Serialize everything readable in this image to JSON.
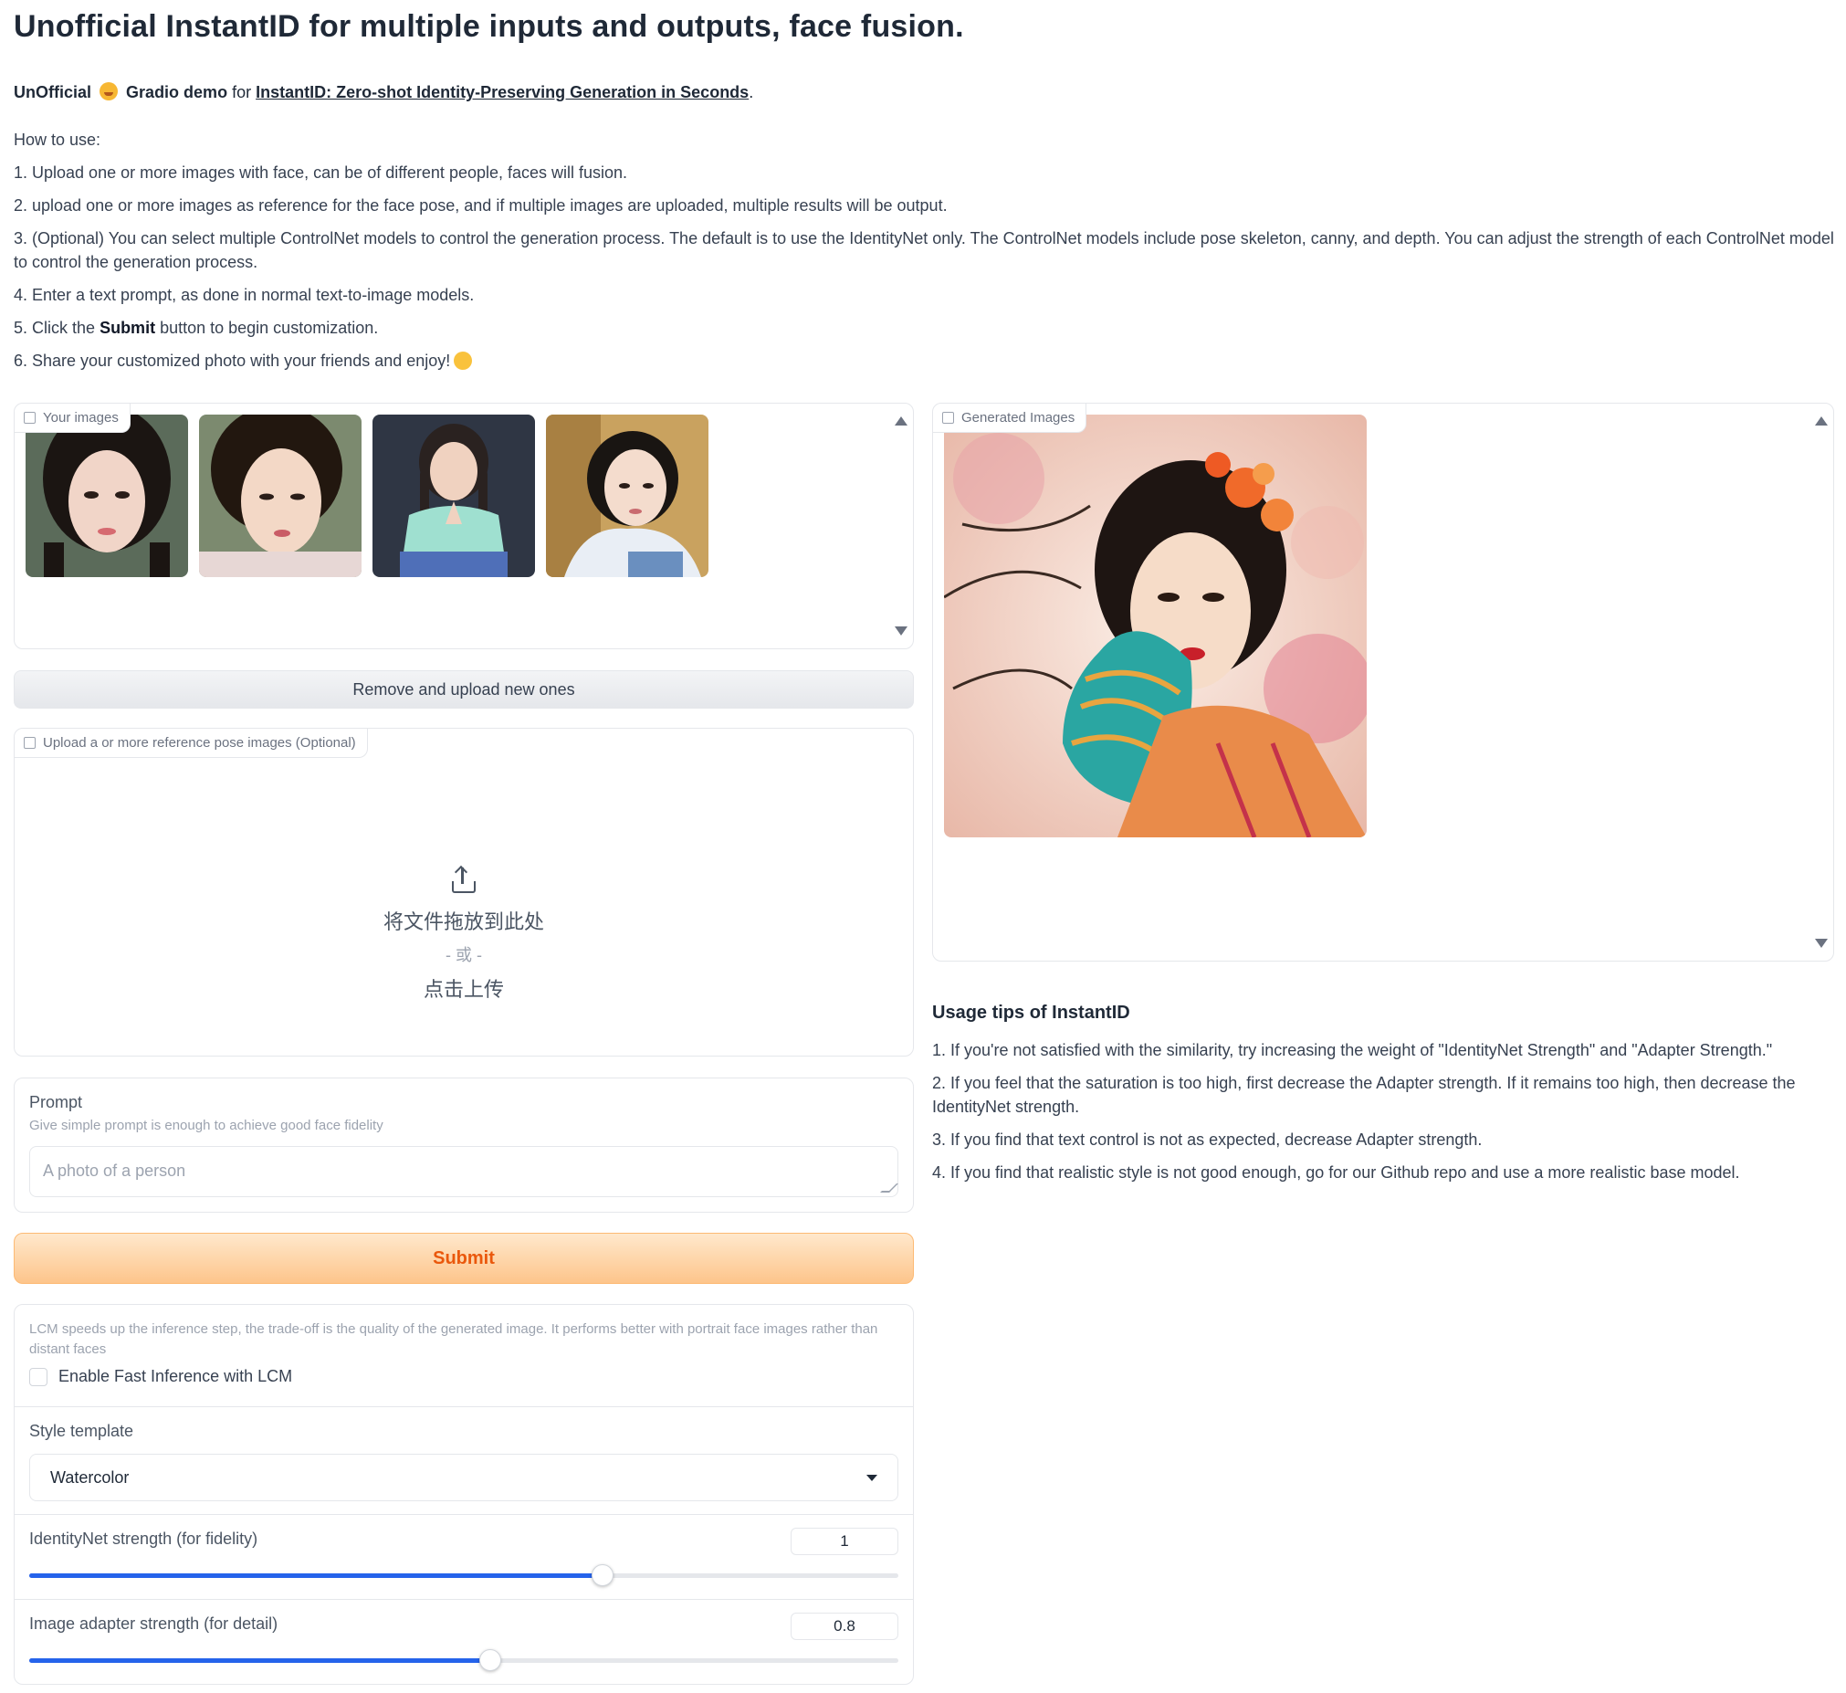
{
  "header": {
    "title": "Unofficial InstantID for multiple inputs and outputs, face fusion.",
    "intro_unofficial": "UnOfficial",
    "intro_gradio": "Gradio demo",
    "intro_for": "for",
    "intro_link": "InstantID: Zero-shot Identity-Preserving Generation in Seconds",
    "intro_period": "."
  },
  "howto": {
    "heading": "How to use:",
    "step1": "1. Upload one or more images with face, can be of different people, faces will fusion.",
    "step2": "2. upload one or more images as reference for the face pose, and if multiple images are uploaded, multiple results will be output.",
    "step3": "3. (Optional) You can select multiple ControlNet models to control the generation process. The default is to use the IdentityNet only. The ControlNet models include pose skeleton, canny, and depth. You can adjust the strength of each ControlNet model to control the generation process.",
    "step4": "4. Enter a text prompt, as done in normal text-to-image models.",
    "step5_a": "5. Click the",
    "step5_b": "Submit",
    "step5_c": "button to begin customization.",
    "step6": "6. Share your customized photo with your friends and enjoy!"
  },
  "gallery": {
    "label": "Your images",
    "thumbs": [
      {
        "name": "face-photo-1",
        "bg": "#5b6b5a",
        "skin": "#f1d5c8",
        "hair": "#1b1512"
      },
      {
        "name": "face-photo-2",
        "bg": "#7c8a6f",
        "skin": "#f3d8c6",
        "hair": "#22170f"
      },
      {
        "name": "face-photo-3",
        "bg": "#2f3644",
        "skin": "#f0d2c0",
        "hair": "#2a2220"
      },
      {
        "name": "face-photo-4",
        "bg": "#c9a25f",
        "skin": "#f4dccd",
        "hair": "#191512"
      }
    ]
  },
  "remove_button": "Remove and upload new ones",
  "pose_upload": {
    "label": "Upload a or more reference pose images (Optional)",
    "drop_text": "将文件拖放到此处",
    "or_text": "- 或 -",
    "click_text": "点击上传"
  },
  "prompt": {
    "label": "Prompt",
    "info": "Give simple prompt is enough to achieve good face fidelity",
    "placeholder": "A photo of a person"
  },
  "submit_button": "Submit",
  "lcm": {
    "info": "LCM speeds up the inference step, the trade-off is the quality of the generated image. It performs better with portrait face images rather than distant faces",
    "checkbox_label": "Enable Fast Inference with LCM",
    "checked": false
  },
  "style_template": {
    "label": "Style template",
    "value": "Watercolor"
  },
  "identitynet": {
    "label": "IdentityNet strength (for fidelity)",
    "value": "1",
    "fraction": 0.66
  },
  "adapter": {
    "label": "Image adapter strength (for detail)",
    "value": "0.8",
    "fraction": 0.53
  },
  "generated": {
    "label": "Generated Images"
  },
  "tips": {
    "title": "Usage tips of InstantID",
    "tip1": "1. If you're not satisfied with the similarity, try increasing the weight of \"IdentityNet Strength\" and \"Adapter Strength.\"",
    "tip2": "2. If you feel that the saturation is too high, first decrease the Adapter strength. If it remains too high, then decrease the IdentityNet strength.",
    "tip3": "3. If you find that text control is not as expected, decrease Adapter strength.",
    "tip4": "4. If you find that realistic style is not good enough, go for our Github repo and use a more realistic base model."
  },
  "colors": {
    "accent": "#2563eb",
    "submit_text": "#ea580c",
    "submit_bg_top": "#ffe8cc",
    "submit_bg_bottom": "#fdc58b"
  }
}
